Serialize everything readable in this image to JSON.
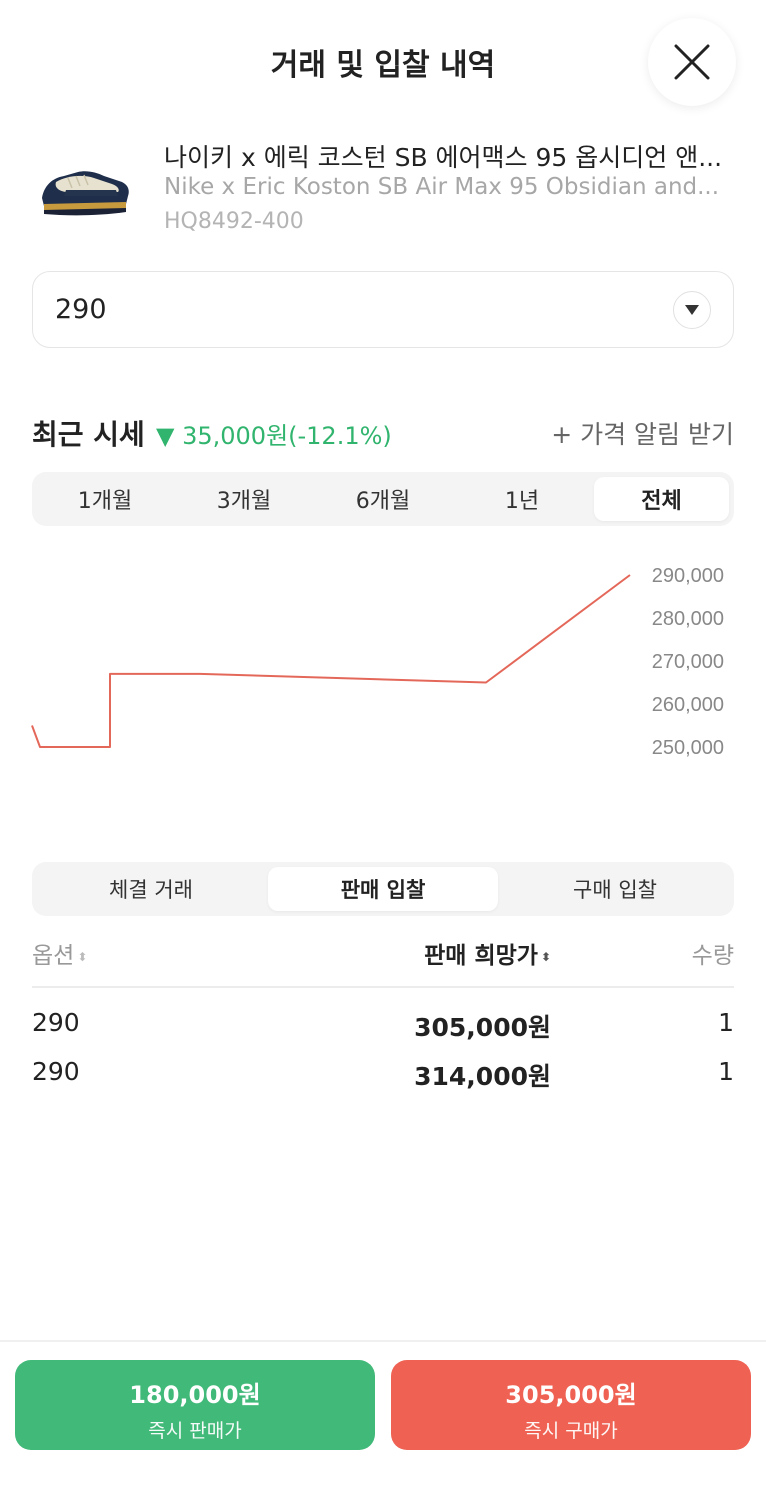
{
  "sheet": {
    "title": "거래 및 입찰 내역"
  },
  "product": {
    "name_ko": "나이키 x 에릭 코스턴 SB 에어맥스 95 옵시디언 앤...",
    "name_en": "Nike x Eric Koston SB Air Max 95 Obsidian and...",
    "code": "HQ8492-400"
  },
  "size_select": {
    "value": "290"
  },
  "recent": {
    "label": "최근 시세",
    "change": "▼ 35,000원(-12.1%)",
    "alert_label": "+ 가격 알림 받기"
  },
  "periods": [
    {
      "label": "1개월",
      "active": false
    },
    {
      "label": "3개월",
      "active": false
    },
    {
      "label": "6개월",
      "active": false
    },
    {
      "label": "1년",
      "active": false
    },
    {
      "label": "전체",
      "active": true
    }
  ],
  "chart_data": {
    "type": "line",
    "y_ticks": [
      "290,000",
      "280,000",
      "270,000",
      "260,000",
      "250,000"
    ],
    "ylim": [
      245000,
      290000
    ],
    "series": [
      {
        "values": [
          255000,
          250000,
          250000,
          250000,
          267000,
          267000,
          265000,
          290000
        ]
      }
    ],
    "color": "#e4685a",
    "grid": false
  },
  "trade_tabs": [
    {
      "label": "체결 거래",
      "active": false
    },
    {
      "label": "판매 입찰",
      "active": true
    },
    {
      "label": "구매 입찰",
      "active": false
    }
  ],
  "table": {
    "headers": {
      "option": "옵션",
      "price": "판매 희망가",
      "qty": "수량"
    },
    "rows": [
      {
        "option": "290",
        "price": "305,000원",
        "qty": "1"
      },
      {
        "option": "290",
        "price": "314,000원",
        "qty": "1"
      }
    ]
  },
  "actions": {
    "sell": {
      "price": "180,000원",
      "label": "즉시 판매가"
    },
    "buy": {
      "price": "305,000원",
      "label": "즉시 구매가"
    }
  },
  "colors": {
    "green": "#41b979",
    "red": "#ef6253",
    "change_green": "#31b46e"
  }
}
